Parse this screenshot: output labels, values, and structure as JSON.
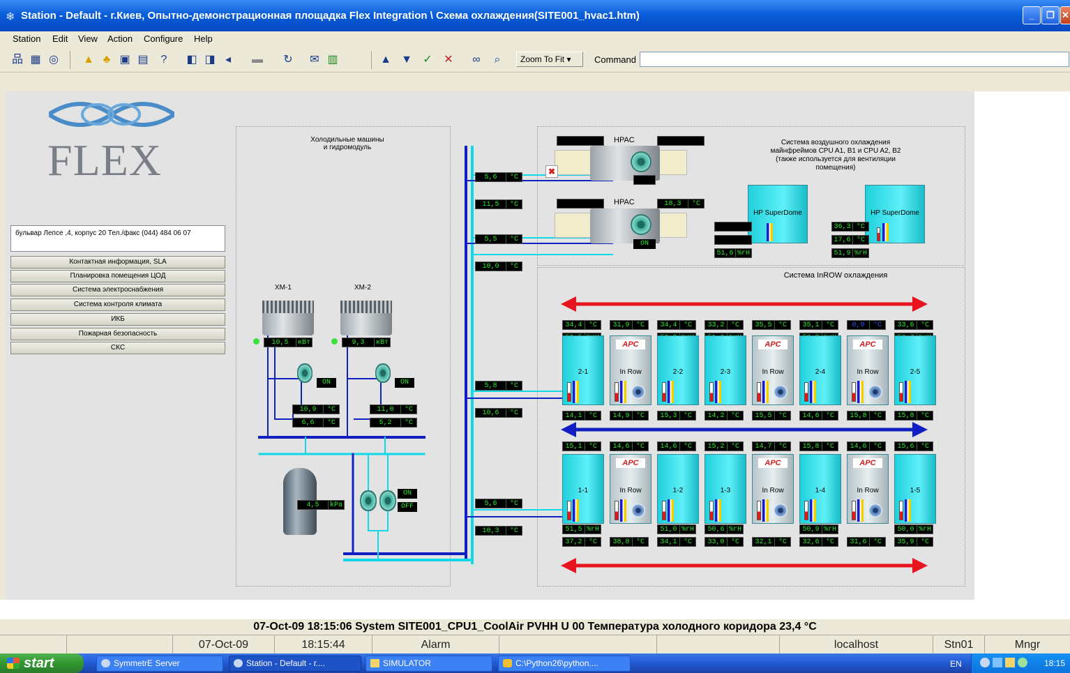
{
  "window": {
    "title": "Station - Default - г.Киев, Опытно-демонстрационная площадка Flex Integration \\ Схема охлаждения(SITE001_hvac1.htm)",
    "minimize": "_",
    "maximize": "❐",
    "close": "✕"
  },
  "menu": [
    "Station",
    "Edit",
    "View",
    "Action",
    "Configure",
    "Help"
  ],
  "toolbar": {
    "zoom": "Zoom To Fit",
    "command_label": "Command",
    "command_value": ""
  },
  "logo": {
    "text": "FLEX"
  },
  "address": "бульвар Лепсе ,4, корпус 20 Тел./факс (044) 484 06 07",
  "nav_buttons": [
    "Контактная информация, SLA",
    "Планировка помещения ЦОД",
    "Система электроснабжения",
    "Система контроля климата",
    "ИКБ",
    "Пожарная безопасность",
    "СКС"
  ],
  "chillers": {
    "title_line1": "Холодильные машины",
    "title_line2": "и гидромодуль",
    "xm1": {
      "name": "ХМ-1",
      "power": "10,5",
      "unit": "кВт",
      "pump": "ON",
      "t1": "10,9",
      "t2": "6,6"
    },
    "xm2": {
      "name": "ХМ-2",
      "power": "9,3",
      "unit": "кВт",
      "pump": "ON",
      "t1": "11,0",
      "t2": "5,2"
    },
    "tank": {
      "pressure": "4,5",
      "unit": "kPa"
    },
    "pumps": {
      "state1": "ON",
      "state2": "OFF"
    }
  },
  "riser": {
    "r1": "5,6",
    "r2": "11,5",
    "r3": "5,5",
    "r4": "10,0",
    "r5": "5,8",
    "r6": "10,6",
    "r7": "5,6",
    "r8": "10,3",
    "unit": "°C"
  },
  "hpac": {
    "label1": "HPAC",
    "label2": "HPAC",
    "temp2": "18,3",
    "state2": "ON",
    "unit": "°C"
  },
  "air_system": {
    "title_line1": "Система воздушного охлаждения",
    "title_line2": "майнфреймов CPU A1, B1 и CPU A2, B2",
    "title_line3": "(также используется для вентиляции",
    "title_line4": "помещения)",
    "sd1": {
      "name": "HP SuperDome",
      "humidity": "51,6"
    },
    "sd2": {
      "name": "HP SuperDome",
      "t1": "36,3",
      "t2": "17,6",
      "humidity": "51,9"
    },
    "hum_unit": "%rH"
  },
  "inrow": {
    "title": "Система InROW охлаждения",
    "apc": "APC",
    "row2": {
      "top": [
        {
          "t": "34,4",
          "h": "50,5"
        },
        {
          "t": "31,9"
        },
        {
          "t": "34,4",
          "h": "50,3"
        },
        {
          "t": "33,2",
          "h": "51,2"
        },
        {
          "t": "35,5"
        },
        {
          "t": "35,1",
          "h": "50,3"
        },
        {
          "t": "0,0"
        },
        {
          "t": "33,6",
          "h": "50,7"
        }
      ],
      "names": [
        "2-1",
        "In Row",
        "2-2",
        "2-3",
        "In Row",
        "2-4",
        "In Row",
        "2-5"
      ],
      "bottom": [
        "14,1",
        "14,9",
        "15,3",
        "14,2",
        "15,5",
        "14,6",
        "15,8",
        "15,8"
      ]
    },
    "row1": {
      "top": [
        "15,1",
        "14,6",
        "14,6",
        "15,2",
        "14,7",
        "15,8",
        "14,6",
        "15,6"
      ],
      "names": [
        "1-1",
        "In Row",
        "1-2",
        "1-3",
        "In Row",
        "1-4",
        "In Row",
        "1-5"
      ],
      "hum": [
        "51,5",
        "",
        "51,0",
        "50,6",
        "",
        "50,9",
        "",
        "50,0"
      ],
      "bottom": [
        "37,2",
        "38,8",
        "34,1",
        "33,0",
        "32,1",
        "32,6",
        "31,6",
        "35,9"
      ]
    },
    "temp_unit": "°C",
    "hum_unit": "%rH"
  },
  "alarm_line": "07-Oct-09  18:15:06  System  SITE001_CPU1_CoolAir  PVHH  U 00 Температура холодного коридора  23,4  °C",
  "status": {
    "date": "07-Oct-09",
    "time": "18:15:44",
    "type": "Alarm",
    "host": "localhost",
    "station": "Stn01",
    "user": "Mngr"
  },
  "taskbar": {
    "start": "start",
    "tasks": [
      "SymmetrE Server",
      "Station - Default - г....",
      "SIMULATOR",
      "C:\\Python26\\python...."
    ],
    "lang": "EN",
    "clock": "18:15"
  },
  "colors": {
    "supply_pipe": "#10b8e8",
    "return_pipe": "#1020c0",
    "display_bg": "#000000",
    "display_text": "#2ee82e",
    "arrow": "#e8141e"
  }
}
